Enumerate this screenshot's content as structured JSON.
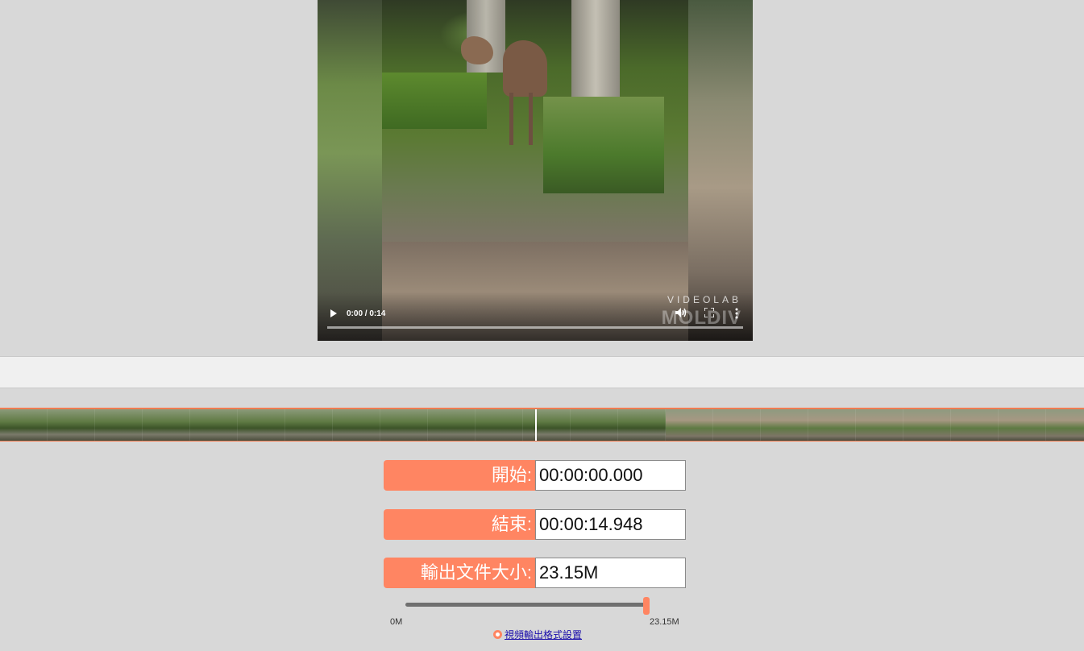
{
  "player": {
    "time": "0:00 / 0:14",
    "watermark_top": "VIDEOLAB",
    "watermark_bottom": "MOLDIV",
    "progress": 0.0
  },
  "form": {
    "start_label": "開始:",
    "start_value": "00:00:00.000",
    "end_label": "結束:",
    "end_value": "00:00:14.948",
    "size_label": "輸出文件大小:",
    "size_value": "23.15M"
  },
  "slider": {
    "min_label": "0M",
    "max_label": "23.15M",
    "value_fraction": 1.0
  },
  "settings": {
    "link_text": "視頻輸出格式設置"
  },
  "colors": {
    "accent": "#ff8562",
    "filmstrip_border": "#f07b50",
    "link": "#1a0dab"
  }
}
